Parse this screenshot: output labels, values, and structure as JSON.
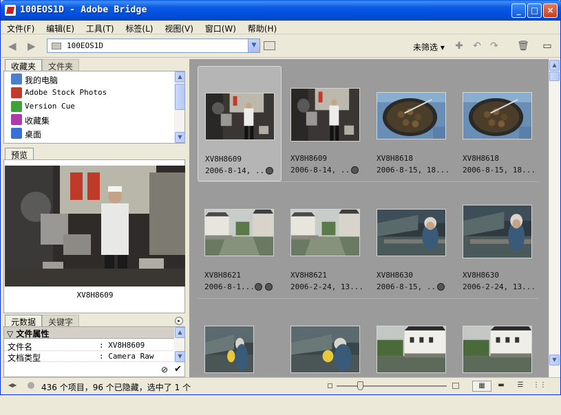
{
  "window": {
    "title": "100EOS1D - Adobe Bridge",
    "buttons": {
      "minimize": "_",
      "maximize": "□",
      "close": "×"
    }
  },
  "menu": [
    "文件(F)",
    "编辑(E)",
    "工具(T)",
    "标签(L)",
    "视图(V)",
    "窗口(W)",
    "帮助(H)"
  ],
  "toolbar": {
    "path": "100EOS1D",
    "filter_label": "未筛选 ▾"
  },
  "favorites_panel": {
    "tabs": [
      "收藏夹",
      "文件夹"
    ],
    "items": [
      {
        "label": "我的电脑",
        "icon": "my-computer-icon",
        "color": "#4a7fd0"
      },
      {
        "label": "Adobe Stock Photos",
        "icon": "stock-photos-icon",
        "color": "#c43a2a"
      },
      {
        "label": "Version Cue",
        "icon": "version-cue-icon",
        "color": "#3fa13a"
      },
      {
        "label": "收藏集",
        "icon": "collections-icon",
        "color": "#b03aa8"
      },
      {
        "label": "桌面",
        "icon": "desktop-icon",
        "color": "#3a6fd6"
      }
    ]
  },
  "preview_panel": {
    "tab": "预览",
    "filename": "XV8H8609"
  },
  "metadata_panel": {
    "tabs": [
      "元数据",
      "关键字"
    ],
    "section": "▽ 文件属性",
    "rows": [
      {
        "key": "文件名",
        "value": ": XV8H8609"
      },
      {
        "key": "文档类型",
        "value": ": Camera Raw"
      }
    ]
  },
  "thumbnails": [
    {
      "name": "XV8H8609",
      "date": "2006-8-14, ...",
      "scene": "kitchen",
      "selected": true,
      "badges": [
        "lock"
      ]
    },
    {
      "name": "XV8H8609",
      "date": "2006-8-14, ...",
      "scene": "kitchen",
      "selected": false,
      "badges": [
        "lock"
      ]
    },
    {
      "name": "XV8H8618",
      "date": "2006-8-15, 18...",
      "scene": "pan",
      "selected": false,
      "badges": []
    },
    {
      "name": "XV8H8618",
      "date": "2006-8-15, 18...",
      "scene": "pan",
      "selected": false,
      "badges": []
    },
    {
      "name": "XV8H8621",
      "date": "2006-8-1...",
      "scene": "canal",
      "selected": false,
      "badges": [
        "settings",
        "crop"
      ]
    },
    {
      "name": "XV8H8621",
      "date": "2006-2-24, 13...",
      "scene": "canal",
      "selected": false,
      "badges": []
    },
    {
      "name": "XV8H8630",
      "date": "2006-8-15, ...",
      "scene": "oldman",
      "selected": false,
      "badges": [
        "settings"
      ]
    },
    {
      "name": "XV8H8630",
      "date": "2006-2-24, 13...",
      "scene": "oldman",
      "selected": false,
      "badges": []
    },
    {
      "name": "",
      "date": "",
      "scene": "fan",
      "selected": false,
      "badges": []
    },
    {
      "name": "",
      "date": "",
      "scene": "fan",
      "selected": false,
      "badges": []
    },
    {
      "name": "",
      "date": "",
      "scene": "houses",
      "selected": false,
      "badges": []
    },
    {
      "name": "",
      "date": "",
      "scene": "houses",
      "selected": false,
      "badges": []
    }
  ],
  "status": {
    "text": "436 个项目，96 个已隐藏，选中了 1 个",
    "thumbnail_size": 0.2
  }
}
